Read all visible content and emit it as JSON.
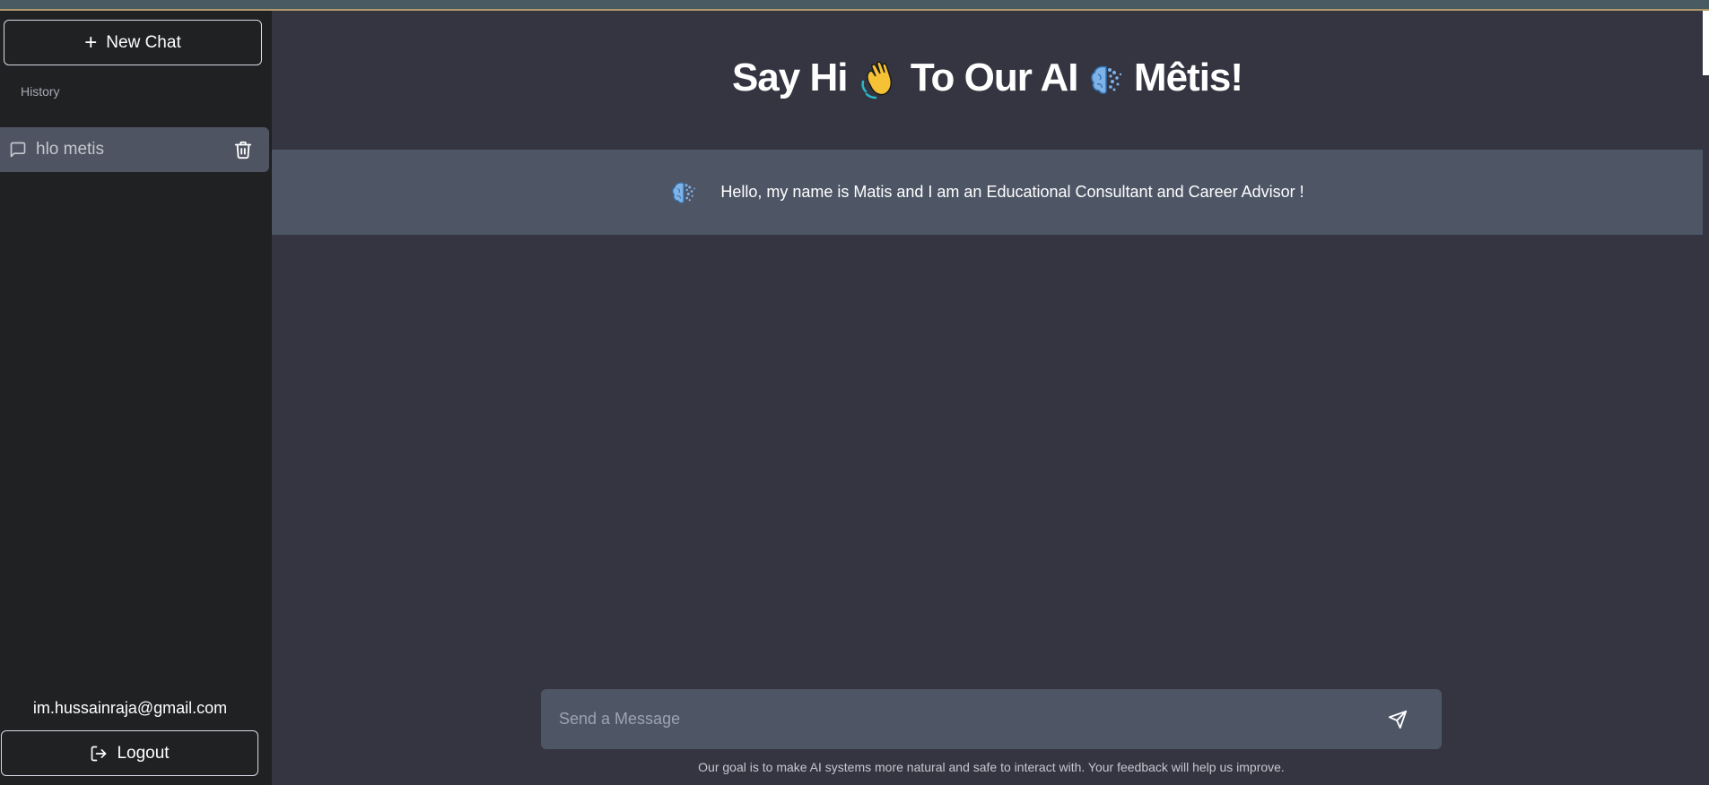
{
  "sidebar": {
    "new_chat_label": "New Chat",
    "history_label": "History",
    "history_items": [
      {
        "label": "hlo metis"
      }
    ],
    "user_email": "im.hussainraja@gmail.com",
    "logout_label": "Logout"
  },
  "main": {
    "title_part1": "Say Hi",
    "title_part2": "To Our AI",
    "title_part3": "Mêtis!",
    "messages": [
      {
        "text": "Hello, my name is Matis and I am an Educational Consultant and Career Advisor !"
      }
    ]
  },
  "composer": {
    "placeholder": "Send a Message",
    "footer_note": "Our goal is to make AI systems more natural and safe to interact with. Your feedback will help us improve."
  },
  "icons": {
    "new_chat": "plus-icon",
    "history_item": "chat-bubble-icon",
    "delete": "trash-icon",
    "logout": "logout-icon",
    "send": "send-icon",
    "wave": "waving-hand-icon",
    "brain": "brain-icon"
  },
  "colors": {
    "sidebar_bg": "#202123",
    "main_bg": "#353541",
    "message_bg": "#4e5666",
    "active_history_bg": "#4e5461"
  }
}
